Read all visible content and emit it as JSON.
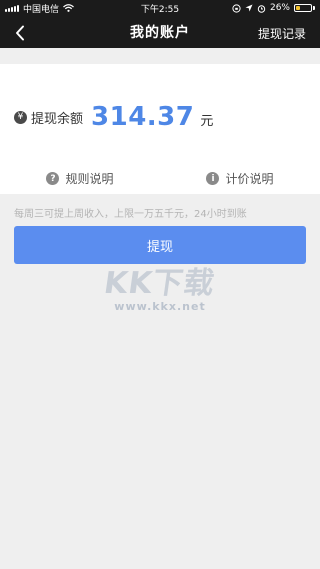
{
  "status_bar": {
    "carrier": "中国电信",
    "time": "下午2:55",
    "battery_percent": "26%",
    "battery_level": 0.26
  },
  "nav": {
    "title": "我的账户",
    "action": "提现记录",
    "back_icon": "chevron-left-icon"
  },
  "balance": {
    "label": "提现余额",
    "amount": "314.37",
    "unit": "元",
    "icon": "yuan-icon"
  },
  "info_links": [
    {
      "label": "规则说明",
      "icon": "help-icon"
    },
    {
      "label": "计价说明",
      "icon": "info-icon"
    }
  ],
  "notice": "每周三可提上周收入，上限一万五千元，24小时到账",
  "withdraw_button": "提现",
  "watermark": {
    "text": "KK下载",
    "url": "www.kkx.net"
  },
  "colors": {
    "accent": "#5b8def",
    "amount": "#4e87e6",
    "nav_bg": "#1b1b1b",
    "page_bg": "#efefef"
  }
}
